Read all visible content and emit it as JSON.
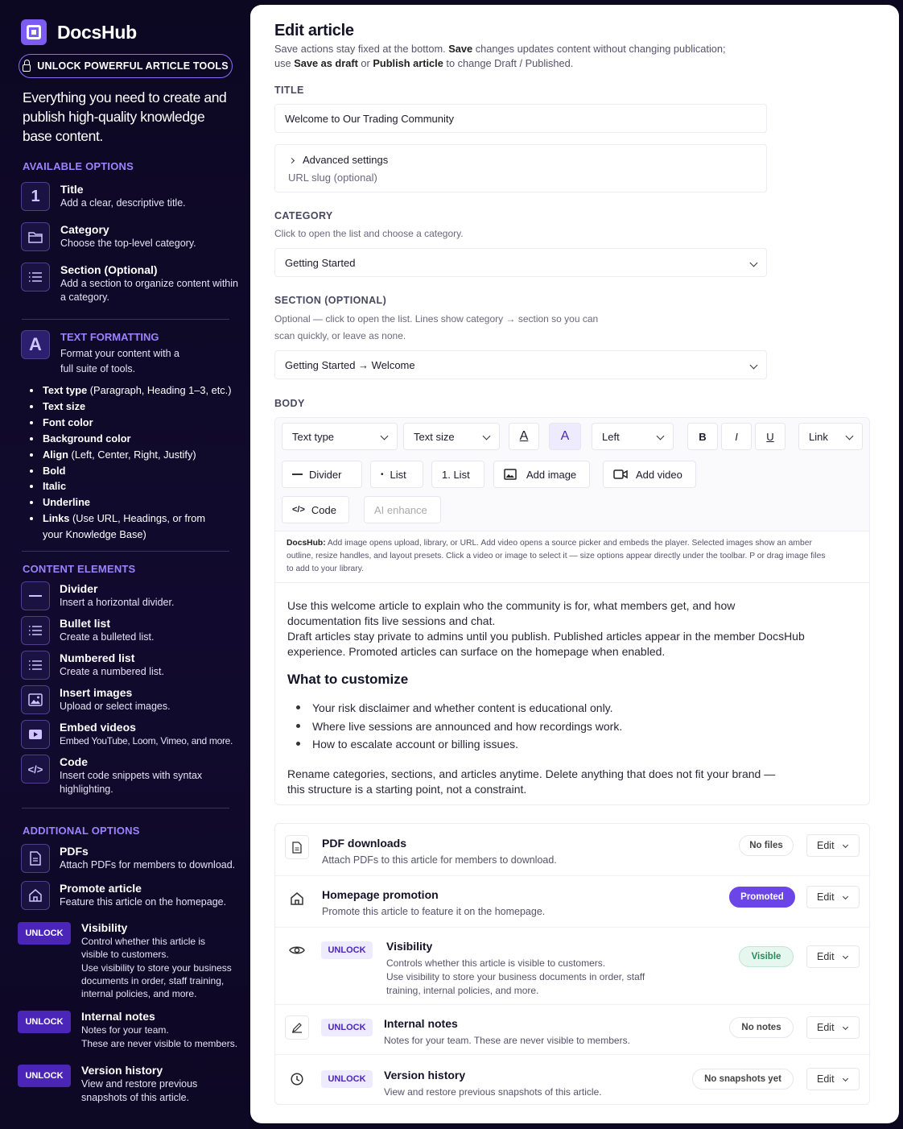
{
  "brand": {
    "name": "DocsHub"
  },
  "sidebar": {
    "unlock_label": "UNLOCK POWERFUL ARTICLE TOOLS",
    "tagline": "Everything you need to create and publish high-quality knowledge base content.",
    "available_heading": "AVAILABLE OPTIONS",
    "available": [
      {
        "icon": "1",
        "title": "Title",
        "desc": "Add a clear, descriptive title."
      },
      {
        "icon": "folder-icon",
        "title": "Category",
        "desc": "Choose the top-level category."
      },
      {
        "icon": "list-icon",
        "title": "Section (Optional)",
        "desc": "Add a section to organize content within a category."
      }
    ],
    "text_formatting": {
      "icon": "A",
      "title": "TEXT FORMATTING",
      "desc": "Format your content with a full suite of tools."
    },
    "formatting_items": [
      {
        "b": "Text type",
        "rest": " (Paragraph, Heading 1–3, etc.)"
      },
      {
        "b": "Text size",
        "rest": ""
      },
      {
        "b": "Font color",
        "rest": ""
      },
      {
        "b": "Background color",
        "rest": ""
      },
      {
        "b": "Align",
        "rest": " (Left, Center, Right, Justify)"
      },
      {
        "b": "Bold",
        "rest": ""
      },
      {
        "b": "Italic",
        "rest": ""
      },
      {
        "b": "Underline",
        "rest": ""
      },
      {
        "b": "Links",
        "rest": " (Use URL, Headings, or from your Knowledge Base)"
      }
    ],
    "content_heading": "CONTENT ELEMENTS",
    "content": [
      {
        "title": "Divider",
        "desc": "Insert a horizontal divider."
      },
      {
        "title": "Bullet list",
        "desc": "Create a bulleted list."
      },
      {
        "title": "Numbered list",
        "desc": "Create a numbered list."
      },
      {
        "title": "Insert images",
        "desc": "Upload or select images."
      },
      {
        "title": "Embed videos",
        "desc": "Embed YouTube, Loom, Vimeo, and more."
      },
      {
        "title": "Code",
        "desc": "Insert code snippets with syntax highlighting."
      }
    ],
    "additional_heading": "ADDITIONAL OPTIONS",
    "additional": [
      {
        "title": "PDFs",
        "desc": "Attach PDFs for members to download."
      },
      {
        "title": "Promote article",
        "desc": "Feature this article on the homepage."
      }
    ],
    "unlock_badge": "UNLOCK",
    "locked": [
      {
        "title": "Visibility",
        "desc": "Control whether this article is visible to customers.\nUse visibility to store your business documents in order, staff training, internal policies, and more."
      },
      {
        "title": "Internal notes",
        "desc": "Notes for your team.\nThese are never visible to members."
      },
      {
        "title": "Version history",
        "desc": "View and restore previous snapshots of this article."
      }
    ]
  },
  "main": {
    "title": "Edit article",
    "note": {
      "p1": "Save actions stay fixed at the bottom. ",
      "b1": "Save",
      "p2": " changes updates content without changing publication;",
      "p3": "use ",
      "b2": "Save as draft",
      "p4": " or ",
      "b3": "Publish article",
      "p5": " to change Draft / Published."
    },
    "title_label": "TITLE",
    "title_value": "Welcome to Our Trading Community",
    "advanced_label": "Advanced settings",
    "slug_placeholder": "URL slug (optional)",
    "category_label": "CATEGORY",
    "category_hint": "Click to open the list and choose a category.",
    "category_value": "Getting Started",
    "section_label": "SECTION (OPTIONAL)",
    "section_hint": "Optional — click to open the list. Lines show category → section so you can scan quickly, or leave as none.",
    "section_value": "Getting Started → Welcome",
    "body_label": "BODY",
    "toolbar": {
      "text_type": "Text type",
      "text_size": "Text size",
      "font_color": "A",
      "bg_color": "A",
      "align": "Left",
      "bold": "B",
      "italic": "I",
      "underline": "U",
      "link": "Link",
      "divider": "Divider",
      "list": "List",
      "numbered": "1. List",
      "image": "Add image",
      "video": "Add video",
      "code": "Code",
      "ai": "AI enhance"
    },
    "docs_note": {
      "b": "DocsHub:",
      "text": " Add image opens upload, library, or URL. Add video opens a source picker and embeds the player. Selected images show an amber outline, resize handles, and layout presets. Click a video or image to select it — size options appear directly under the toolbar. P or drag image files to add to your library."
    },
    "body": {
      "p1": "Use this welcome article to explain who the community is for, what members get, and how documentation fits live sessions and chat.",
      "p2": "Draft articles stay private to admins until you publish. Published articles appear in the member DocsHub experience. Promoted articles can surface on the homepage when enabled.",
      "heading": "What to customize",
      "bullets": [
        "Your risk disclaimer and whether content is educational only.",
        "Where live sessions are announced and how recordings work.",
        "How to escalate account or billing issues."
      ],
      "p3": "Rename categories, sections, and articles anytime. Delete anything that does not fit your brand — this structure is a starting point, not a constraint."
    },
    "cards": [
      {
        "title": "PDF downloads",
        "desc": "Attach PDFs to this article for members to download.",
        "status": "No files",
        "edit": "Edit"
      },
      {
        "title": "Homepage promotion",
        "desc": "Promote this article to feature it on the homepage.",
        "status": "Promoted",
        "edit": "Edit"
      },
      {
        "title": "Visibility",
        "desc": "Controls whether this article is visible to customers.\nUse visibility to store your business documents in order, staff training, internal policies, and more.",
        "status": "Visible",
        "edit": "Edit",
        "badge": "UNLOCK"
      },
      {
        "title": "Internal notes",
        "desc": "Notes for your team. These are never visible to members.",
        "status": "No notes",
        "edit": "Edit",
        "badge": "UNLOCK"
      },
      {
        "title": "Version history",
        "desc": "View and restore previous snapshots of this article.",
        "status": "No snapshots yet",
        "edit": "Edit",
        "badge": "UNLOCK"
      }
    ]
  },
  "colors": {
    "accent": "#6c45e8",
    "sidebar_bg": "#0c0822",
    "heading_purple": "#9d82ff"
  }
}
